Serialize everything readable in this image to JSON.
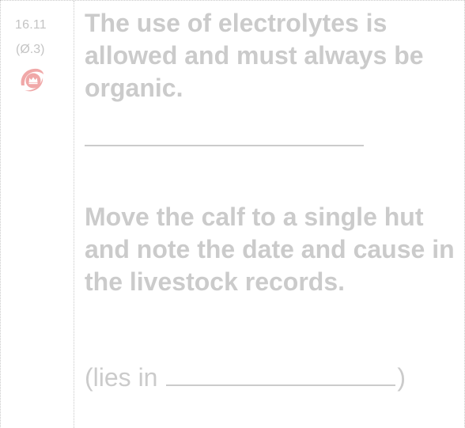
{
  "item": {
    "number": "16.11",
    "reference": "(Ø.3)",
    "icon": "organic-state-control-seal-icon",
    "icon_color": "#f0a8a8"
  },
  "requirement": {
    "text": "The use of electrolytes is allowed and must always be organic."
  },
  "action": {
    "text": "Move the calf to a single hut and note the date and cause in the livestock records.",
    "lies_in_prefix": "(lies in",
    "lies_in_suffix": ")"
  },
  "colors": {
    "text": "#cbcbcb",
    "small_text": "#c4c4c4",
    "border": "#c9c9c9"
  }
}
